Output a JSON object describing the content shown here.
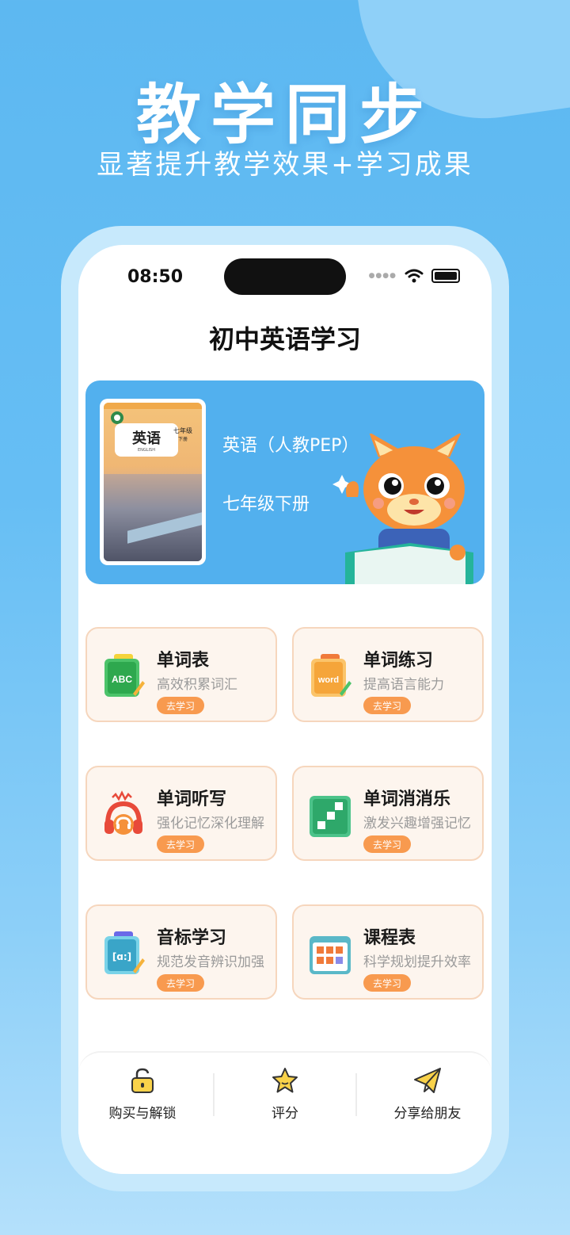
{
  "hero": {
    "title": "教学同步",
    "subtitle": "显著提升教学效果+学习成果"
  },
  "status_bar": {
    "time": "08:50"
  },
  "header": {
    "title": "初中英语学习"
  },
  "banner": {
    "subject": "英语（人教PEP）",
    "grade": "七年级下册",
    "book": {
      "title": "英语",
      "subtitle": "ENGLISH",
      "grade": "七年级",
      "volume": "下册"
    }
  },
  "cards": [
    {
      "title": "单词表",
      "desc": "高效积累词汇",
      "button": "去学习",
      "icon": "abc-notebook-icon"
    },
    {
      "title": "单词练习",
      "desc": "提高语言能力",
      "button": "去学习",
      "icon": "word-notebook-icon"
    },
    {
      "title": "单词听写",
      "desc": "强化记忆深化理解",
      "button": "去学习",
      "icon": "headphones-icon"
    },
    {
      "title": "单词消消乐",
      "desc": "激发兴趣增强记忆",
      "button": "去学习",
      "icon": "puzzle-blocks-icon"
    },
    {
      "title": "音标学习",
      "desc": "规范发音辨识加强",
      "button": "去学习",
      "icon": "phonetic-notebook-icon"
    },
    {
      "title": "课程表",
      "desc": "科学规划提升效率",
      "button": "去学习",
      "icon": "schedule-icon"
    }
  ],
  "tabbar": [
    {
      "label": "购买与解锁",
      "icon": "unlock-icon"
    },
    {
      "label": "评分",
      "icon": "star-icon"
    },
    {
      "label": "分享给朋友",
      "icon": "paper-plane-icon"
    }
  ],
  "colors": {
    "background": "#5db8f1",
    "banner": "#52b0ee",
    "card_bg": "#fdf5ee",
    "card_border": "#f6d6bd",
    "button": "#f89a4f"
  }
}
